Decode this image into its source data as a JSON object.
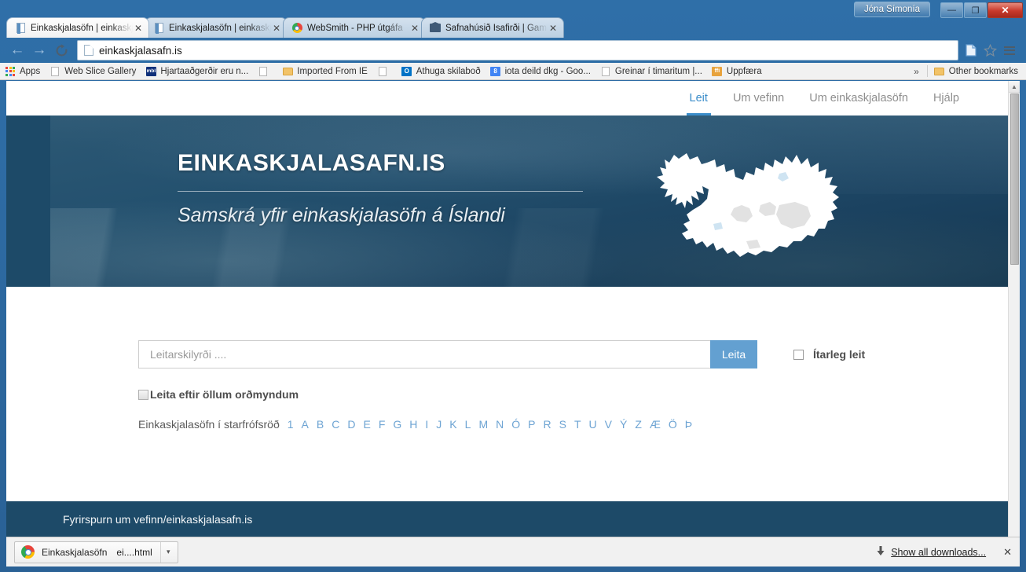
{
  "window": {
    "user_label": "Jóna Símonía",
    "minimize": "—",
    "maximize": "❐",
    "close": "✕"
  },
  "tabs": [
    {
      "title": "Einkaskjalasöfn | einkaskja",
      "icon": "document-icon",
      "active": true,
      "close": "✕"
    },
    {
      "title": "Einkaskjalasöfn | einkaskja",
      "icon": "document-icon",
      "active": false,
      "close": "✕"
    },
    {
      "title": "WebSmith - PHP útgáfa",
      "icon": "chrome-icon",
      "active": false,
      "close": "✕"
    },
    {
      "title": "Safnahúsið Ísafirði | Gamla",
      "icon": "museum-icon",
      "active": false,
      "close": "✕"
    }
  ],
  "toolbar": {
    "back_icon": "←",
    "forward_icon": "→",
    "reload_icon": "⟳",
    "url": "einkaskjalasafn.is",
    "page_icon": "page-icon",
    "star_icon": "☆",
    "menu_icon": "hamburger-icon"
  },
  "bookmarks": {
    "items": [
      {
        "label": "Apps",
        "icon": "apps-grid-icon"
      },
      {
        "label": "Web Slice Gallery",
        "icon": "document-icon"
      },
      {
        "label": "Hjartaaðgerðir eru n...",
        "icon": "mbl-icon",
        "icon_text": "mbl",
        "icon_color": "#10307a"
      },
      {
        "label": "",
        "icon": "document-icon"
      },
      {
        "label": "Imported From IE",
        "icon": "folder-icon"
      },
      {
        "label": "",
        "icon": "document-icon"
      },
      {
        "label": "Athuga skilaboð",
        "icon": "outlook-icon",
        "icon_text": "O",
        "icon_color": "#0072c6"
      },
      {
        "label": "iota deild dkg - Goo...",
        "icon": "google-icon",
        "icon_text": "8",
        "icon_color": "#4285f4"
      },
      {
        "label": "Greinar í timaritum |...",
        "icon": "document-icon"
      },
      {
        "label": "Uppfæra",
        "icon": "update-icon",
        "icon_text": "ffi",
        "icon_color": "#e8a33d"
      }
    ],
    "overflow": "»",
    "other_bookmarks": "Other bookmarks"
  },
  "site": {
    "nav": [
      {
        "label": "Leit",
        "active": true
      },
      {
        "label": "Um vefinn",
        "active": false
      },
      {
        "label": "Um einkaskjalasöfn",
        "active": false
      },
      {
        "label": "Hjálp",
        "active": false
      }
    ],
    "hero": {
      "title": "EINKASKJALASAFN.IS",
      "subtitle": "Samskrá yfir einkaskjalasöfn á Íslandi",
      "map_icon": "iceland-map-icon"
    },
    "search": {
      "placeholder": "Leitarskilyrði ....",
      "value": "",
      "button_label": "Leita",
      "advanced_label": "Ítarleg leit",
      "advanced_checked": false,
      "allforms_label": "Leita eftir öllum orðmyndum",
      "allforms_checked": false
    },
    "alphabet": {
      "label": "Einkaskjalasöfn í starfrófsröð",
      "letters": [
        "1",
        "A",
        "B",
        "C",
        "D",
        "E",
        "F",
        "G",
        "H",
        "I",
        "J",
        "K",
        "L",
        "M",
        "N",
        "Ó",
        "P",
        "R",
        "S",
        "T",
        "U",
        "V",
        "Ý",
        "Z",
        "Æ",
        "Ö",
        "Þ"
      ]
    },
    "footer": {
      "text": "Fyrirspurn um vefinn/einkaskjalasafn.is"
    },
    "scrollbar": {
      "up_arrow": "▲"
    }
  },
  "downloads": {
    "file_name": "Einkaskjalasöfn",
    "file_sub": "ei....html",
    "caret": "▾",
    "show_all": "Show all downloads...",
    "download_icon": "download-arrow-icon",
    "close": "✕"
  },
  "colors": {
    "accent_blue": "#3b8dca",
    "button_blue": "#63a0d1",
    "dark_blue": "#1d4a68",
    "link_blue": "#6ea4d3"
  }
}
